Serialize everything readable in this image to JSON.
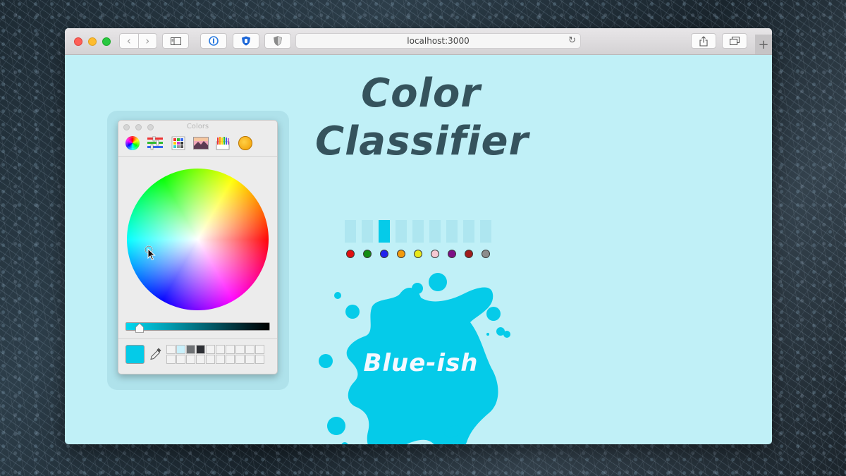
{
  "browser": {
    "address": "localhost:3000",
    "nav_back": "‹",
    "nav_forward": "›",
    "new_tab": "+",
    "reload_icon": "↻"
  },
  "colors_panel": {
    "title": "Colors",
    "mode_icons": [
      "color-wheel-icon",
      "color-sliders-icon",
      "color-palettes-icon",
      "image-palettes-icon",
      "pencils-icon",
      "crayon-icon"
    ],
    "current_color": "#04cbe8",
    "brightness_level": 0.1,
    "saved_swatches": [
      "#f2f2f2",
      "#c9f0fb",
      "#6e7174",
      "#2e3035"
    ]
  },
  "page": {
    "title_line1": "Color",
    "title_line2": "Classifier",
    "result": "Blue-ish",
    "classes": [
      {
        "color": "#e01010",
        "prob": 0.0
      },
      {
        "color": "#138d13",
        "prob": 0.0
      },
      {
        "color": "#2222ee",
        "prob": 1.0
      },
      {
        "color": "#f29a0c",
        "prob": 0.0
      },
      {
        "color": "#e8e81a",
        "prob": 0.0
      },
      {
        "color": "#f5c8d2",
        "prob": 0.0
      },
      {
        "color": "#7d0f86",
        "prob": 0.0
      },
      {
        "color": "#a01c1c",
        "prob": 0.0
      },
      {
        "color": "#8c8c8c",
        "prob": 0.0
      }
    ],
    "accent": "#05cbe9",
    "background": "#c0f0f7"
  }
}
